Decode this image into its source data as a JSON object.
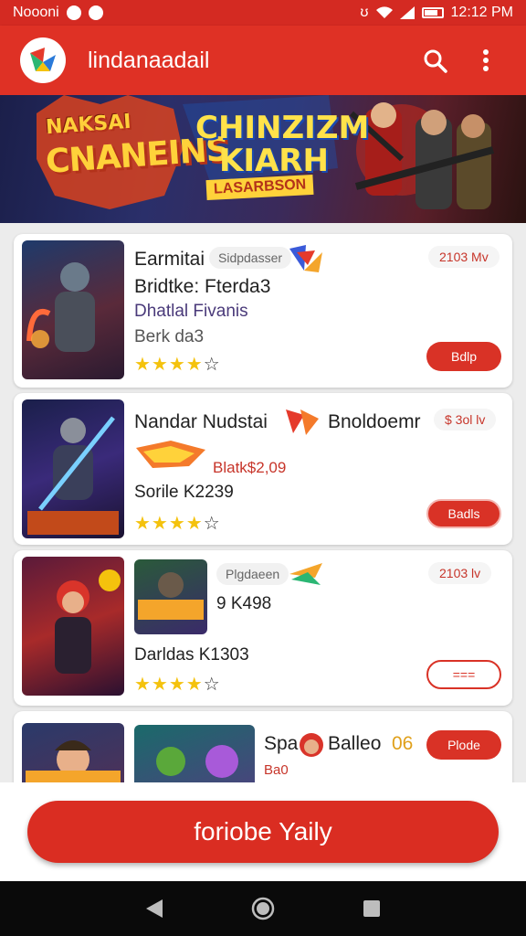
{
  "status_bar": {
    "left_text": "Noooni",
    "time": "12:12 PM"
  },
  "app_bar": {
    "title": "lindanaadail"
  },
  "banner": {
    "line1": "NAKSAI",
    "line2": "CNANEINS",
    "line4": "CHINZIZM",
    "line5": "KIARH",
    "line6": "LASARBSON"
  },
  "cards": [
    {
      "title": "Earmitai",
      "chip": "Sidpdasser",
      "price": "2103 Mv",
      "line2": "Bridtke: Fterda3",
      "line3": "Dhatlal Fivanis",
      "line4": "Berk da3",
      "rating": "4 of 5",
      "button": "Bdlp"
    },
    {
      "title": "Nandar Nudstai",
      "extra": "Bnoldoemr",
      "price": "$ 3ol lv",
      "line2": "Blatk$2,09",
      "line3": "Sorile K2239",
      "rating": "4 of 5",
      "button": "Badls"
    },
    {
      "chip": "Plgdaeen",
      "price": "2103 lv",
      "line2": "9 K498",
      "line3": "Darldas K1303",
      "rating": "4 of 5",
      "button": "==="
    },
    {
      "title": "Spa",
      "extra": "Balleo",
      "extra_num": "06",
      "line2": "Ba0",
      "button": "Plode"
    }
  ],
  "cta": {
    "label": "foriobe Yaily"
  }
}
